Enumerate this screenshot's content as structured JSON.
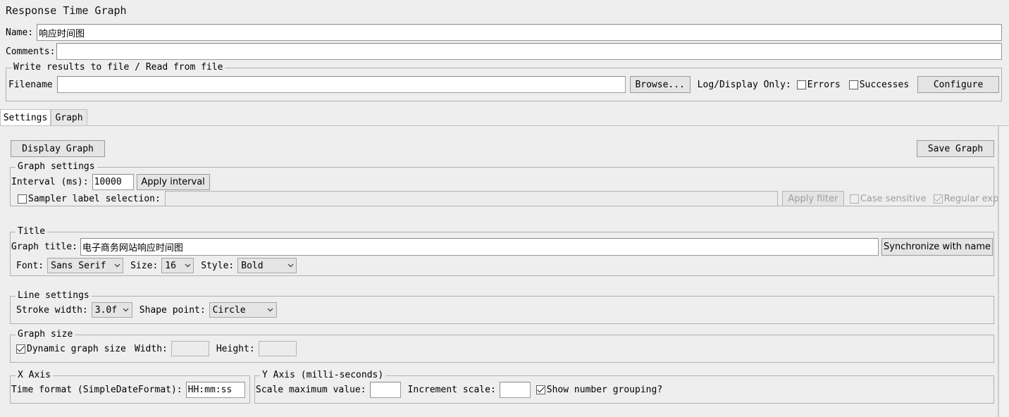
{
  "header": {
    "title": "Response Time Graph",
    "name_label": "Name:",
    "name_value": "响应时间图",
    "comments_label": "Comments:",
    "comments_value": ""
  },
  "file_panel": {
    "legend": "Write results to file / Read from file",
    "filename_label": "Filename",
    "filename_value": "",
    "browse_button": "Browse...",
    "log_display_label": "Log/Display Only:",
    "errors_label": "Errors",
    "errors_checked": false,
    "successes_label": "Successes",
    "successes_checked": false,
    "configure_button": "Configure"
  },
  "tabs": [
    {
      "label": "Settings",
      "active": true
    },
    {
      "label": "Graph",
      "active": false
    }
  ],
  "toolbar": {
    "display_graph_button": "Display Graph",
    "save_graph_button": "Save Graph"
  },
  "graph_settings": {
    "legend": "Graph settings",
    "interval_label": "Interval (ms):",
    "interval_value": "10000",
    "apply_interval_button": "Apply interval",
    "sampler_label_selection": "Sampler label selection:",
    "sampler_checked": false,
    "sampler_filter_value": "",
    "apply_filter_button": "Apply filter",
    "apply_filter_disabled": true,
    "case_sensitive_label": "Case sensitive",
    "case_sensitive_checked": false,
    "regular_exp_label": "Regular exp.",
    "regular_exp_checked": true
  },
  "title_settings": {
    "legend": "Title",
    "graph_title_label": "Graph title:",
    "graph_title_value": "电子商务网站响应时间图",
    "synchronize_button": "Synchronize with name",
    "font_label": "Font:",
    "font_value": "Sans Serif",
    "size_label": "Size:",
    "size_value": "16",
    "style_label": "Style:",
    "style_value": "Bold"
  },
  "line_settings": {
    "legend": "Line settings",
    "stroke_width_label": "Stroke width:",
    "stroke_width_value": "3.0f",
    "shape_point_label": "Shape point:",
    "shape_point_value": "Circle"
  },
  "graph_size": {
    "legend": "Graph size",
    "dynamic_label": "Dynamic graph size",
    "dynamic_checked": true,
    "width_label": "Width:",
    "width_value": "",
    "height_label": "Height:",
    "height_value": ""
  },
  "x_axis": {
    "legend": "X Axis",
    "time_format_label": "Time format (SimpleDateFormat):",
    "time_format_value": "HH:mm:ss"
  },
  "y_axis": {
    "legend": "Y Axis (milli-seconds)",
    "scale_max_label": "Scale maximum value:",
    "scale_max_value": "",
    "increment_label": "Increment scale:",
    "increment_value": "",
    "number_grouping_label": "Show number grouping?",
    "number_grouping_checked": true
  },
  "colors": {
    "background": "#eeeeee",
    "field_background": "#ffffff",
    "border": "#b0b0b0",
    "button": "#e4e4e4",
    "disabled_text": "#9d9d9d"
  }
}
